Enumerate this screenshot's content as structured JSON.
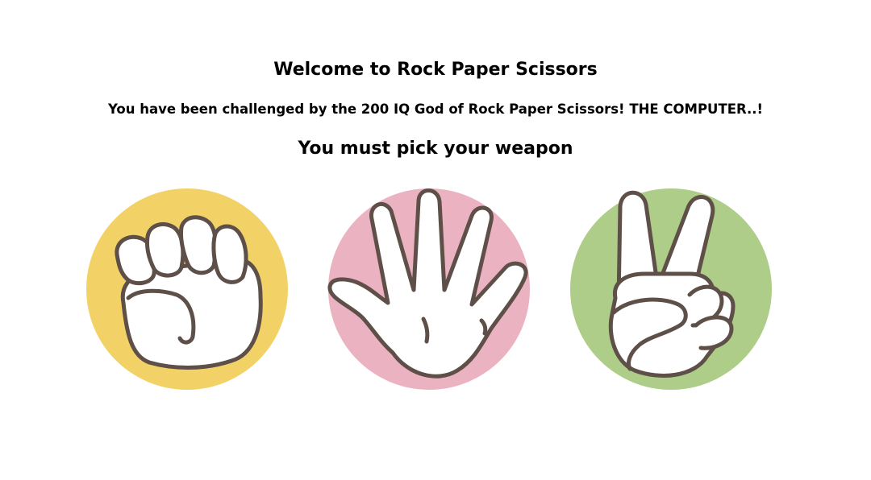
{
  "header": {
    "title": "Welcome to Rock Paper Scissors",
    "subtitle": "You have been challenged by the 200 IQ God of Rock Paper Scissors! THE COMPUTER..!",
    "prompt": "You must pick your weapon"
  },
  "weapons": [
    {
      "id": "rock",
      "icon": "fist-icon",
      "circle_color": "#f2d267"
    },
    {
      "id": "paper",
      "icon": "open-hand-icon",
      "circle_color": "#ebb2c2"
    },
    {
      "id": "scissors",
      "icon": "peace-sign-icon",
      "circle_color": "#aecd88"
    }
  ],
  "colors": {
    "outline": "#5e5048",
    "hand_fill": "#ffffff",
    "background": "#ffffff"
  }
}
